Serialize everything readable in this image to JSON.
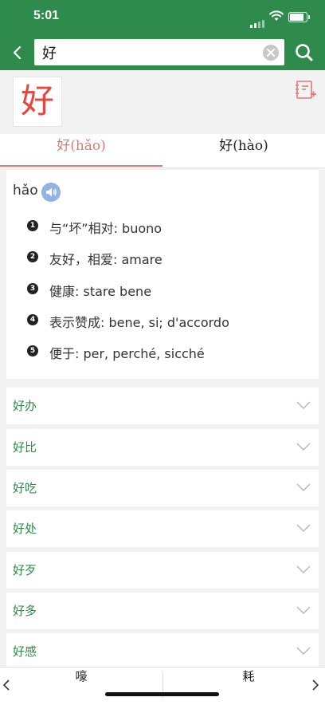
{
  "status": {
    "time": "5:01"
  },
  "search": {
    "value": "好"
  },
  "entry": {
    "character": "好"
  },
  "tabs": [
    {
      "label": "好(hǎo)",
      "active": true
    },
    {
      "label": "好(hào)",
      "active": false
    }
  ],
  "definition": {
    "pinyin": "hǎo",
    "items": [
      {
        "num": "1",
        "text": "与“坏”相对: buono"
      },
      {
        "num": "2",
        "text": "友好，相爱: amare"
      },
      {
        "num": "3",
        "text": "健康: stare bene"
      },
      {
        "num": "4",
        "text": "表示赞成: bene, si; d'accordo"
      },
      {
        "num": "5",
        "text": "便于: per, perché, sicché"
      }
    ]
  },
  "related_words": [
    "好办",
    "好比",
    "好吃",
    "好处",
    "好歹",
    "好多",
    "好感"
  ],
  "footer": {
    "prev_word": "嚎",
    "next_word": "耗"
  },
  "colors": {
    "brand_green": "#2f8b4b",
    "accent_red": "#e6463d",
    "tab_active": "#e07a74"
  }
}
